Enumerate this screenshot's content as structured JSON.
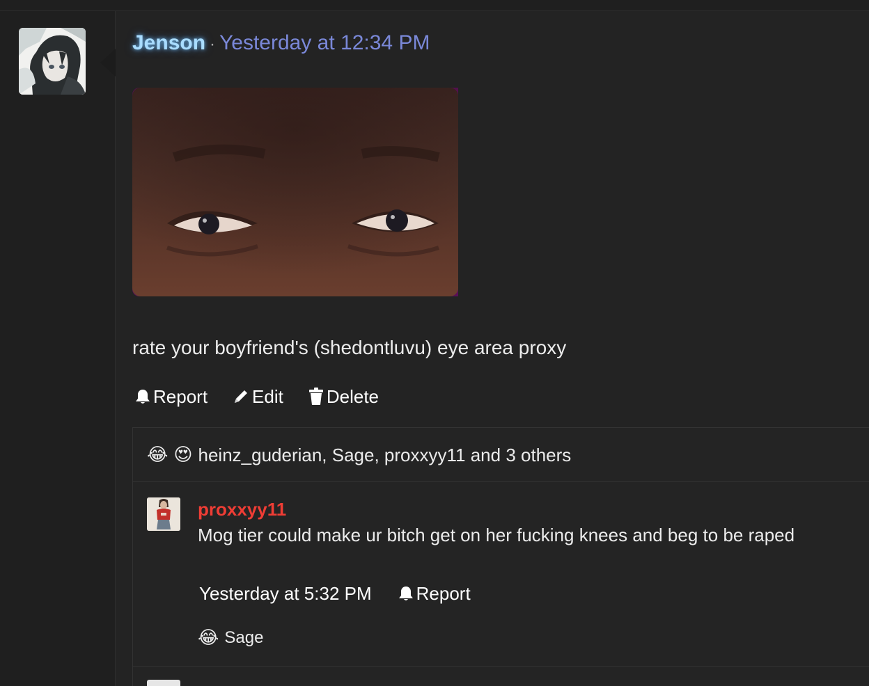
{
  "post": {
    "author": "Jenson",
    "separator": "·",
    "timestamp": "Yesterday at 12:34 PM",
    "text": "rate your boyfriend's (shedontluvu) eye area proxy",
    "actions": {
      "report": "Report",
      "edit": "Edit",
      "delete": "Delete"
    }
  },
  "reactions": {
    "emojis": [
      "😂",
      "😍"
    ],
    "summary": "heinz_guderian, Sage, proxxyy11 and 3 others"
  },
  "comment": {
    "author": "proxxyy11",
    "text": "Mog tier could make ur bitch get on her fucking knees and beg to be raped",
    "timestamp": "Yesterday at 5:32 PM",
    "report": "Report",
    "reaction_emoji": "😂",
    "reaction_user": "Sage"
  },
  "colors": {
    "author_glow": "#a9dcff",
    "timestamp": "#7a88d8",
    "comment_author": "#ef3d35",
    "background": "#232323"
  }
}
